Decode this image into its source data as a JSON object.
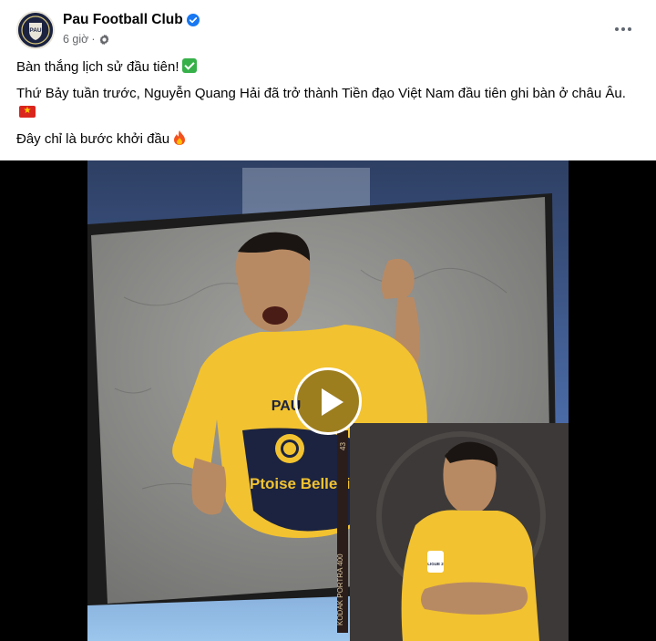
{
  "post": {
    "page_name": "Pau Football Club",
    "time": "6 giờ",
    "separator": "·",
    "text": {
      "line1": "Bàn thắng lịch sử đầu tiên!",
      "line2": "Thứ Bảy tuần trước, Nguyễn Quang Hải đã trở thành Tiền đạo Việt Nam đầu tiên ghi bàn ở châu Âu.",
      "line3": "Đây chỉ là bước khởi đầu"
    },
    "icons": {
      "verified": "verified-badge-icon",
      "audience": "globe-icon",
      "more": "more-options-icon",
      "line1_emoji": "check-mark-emoji",
      "line2_emoji": "vietnam-flag-emoji",
      "line3_emoji": "fire-emoji",
      "play": "play-icon"
    },
    "media": {
      "type": "video",
      "avatar_text": "PAU",
      "sponsor_text": "Ptoise Bellevie",
      "shirt_brand": "PAU",
      "film_text": "KODAK PORTRA 400",
      "film_number": "43",
      "badge_text": "LIGUE 2"
    },
    "colors": {
      "verified": "#1877f2",
      "secondary_text": "#65676b",
      "jersey_yellow": "#f2c230",
      "jersey_navy": "#1b2340"
    }
  }
}
